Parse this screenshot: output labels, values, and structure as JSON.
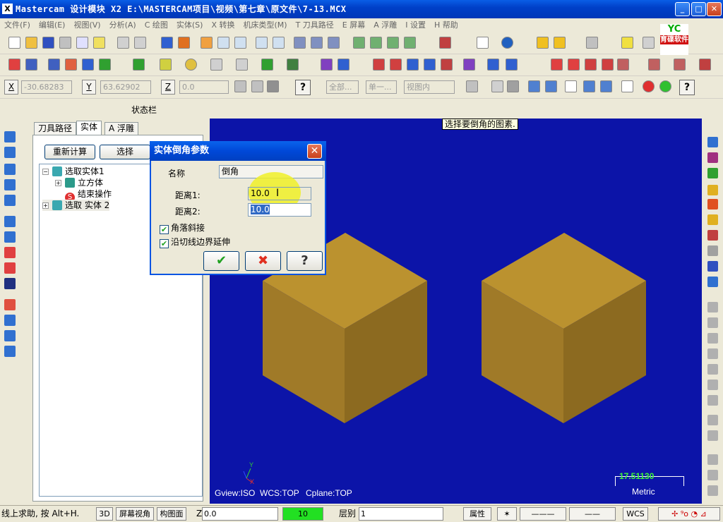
{
  "window": {
    "title": "Mastercam 设计模块  X2  E:\\MASTERCAM项目\\视频\\第七章\\原文件\\7-13.MCX",
    "app_icon": "X",
    "minimize": "_",
    "maximize": "□",
    "close": "✕"
  },
  "menubar": {
    "items": [
      "文件(F)",
      "编辑(E)",
      "视图(V)",
      "分析(A)",
      "C 绘图",
      "实体(S)",
      "X 转换",
      "机床类型(M)",
      "T 刀具路径",
      "E 屏幕",
      "A 浮雕",
      "I 设置",
      "H 帮助"
    ]
  },
  "logo": {
    "top": "YC",
    "bottom": "育碟软件"
  },
  "coords_toolbar": {
    "x_label": "X",
    "x_value": "-30.68283",
    "y_label": "Y",
    "y_value": "63.62902",
    "z_label": "Z",
    "z_value": "0.0",
    "all_button": "全部...",
    "single_button": "单一...",
    "view_select": "视图内"
  },
  "status_label": "状态栏",
  "manager": {
    "tabs": [
      "刀具路径",
      "实体",
      "A 浮雕"
    ],
    "recalc_button": "重新计算",
    "select_button": "选择",
    "tree": [
      {
        "label": "选取实体1",
        "expander": "−"
      },
      {
        "label": "立方体",
        "expander": "+"
      },
      {
        "label": "结束操作",
        "expander": ""
      },
      {
        "label": "选取 实体 2",
        "expander": "+"
      }
    ]
  },
  "viewport": {
    "prompt": "选择要倒角的图素.",
    "gview": "Gview:ISO",
    "wcs": "WCS:TOP",
    "cplane": "Cplane:TOP",
    "axis_y": "Y",
    "axis_x": "X",
    "scale_value": "17.51130",
    "scale_unit": "Metric"
  },
  "dialog": {
    "title": "实体倒角参数",
    "name_label": "名称",
    "name_value": "倒角",
    "dist1_label": "距离1:",
    "dist1_value": "10.0",
    "dist2_label": "距离2:",
    "dist2_value": "10.0",
    "check1_label": "角落斜接",
    "check1_checked": true,
    "check2_label": "沿切线边界延伸",
    "check2_checked": true,
    "ok": "✔",
    "cancel": "✖",
    "help": "?"
  },
  "bottombar": {
    "hint": "线上求助, 按 Alt+H.",
    "btn_3d": "3D",
    "btn_view": "屏幕视角",
    "btn_plane": "构图面",
    "z_label": "Z",
    "z_value": "0.0",
    "color_value": "10",
    "level_label": "层别",
    "level_value": "1",
    "attr_button": "属性",
    "wcs_button": "WCS"
  },
  "colors": {
    "viewport_bg": "#0c14a8",
    "cube_top": "#bb922f",
    "cube_left": "#a07a28",
    "cube_right": "#8c6a20",
    "color_swatch": "#22e022"
  }
}
